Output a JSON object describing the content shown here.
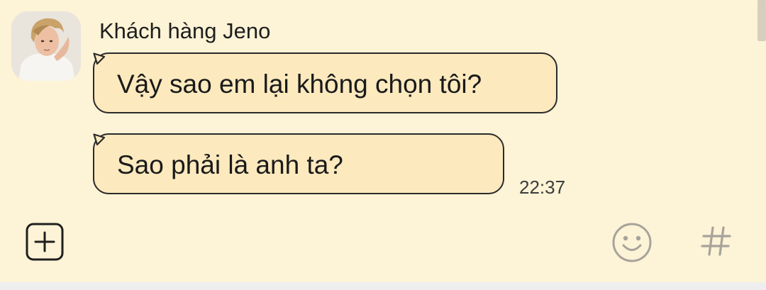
{
  "chat": {
    "sender_name": "Khách hàng Jeno",
    "messages": [
      {
        "text": "Vậy sao em lại không chọn tôi?"
      },
      {
        "text": "Sao phải là anh ta?",
        "time": "22:37"
      }
    ]
  },
  "input_bar": {
    "left_icon": "plus-square-icon",
    "emoji_icon": "smiley-icon",
    "hash_icon": "hashtag-icon"
  },
  "colors": {
    "background": "#FDF3D6",
    "bubble_fill": "#FCE9BE",
    "bubble_border": "#2A2A2A",
    "icon_gray": "#A7A39B",
    "icon_dark": "#1F1F1F"
  }
}
